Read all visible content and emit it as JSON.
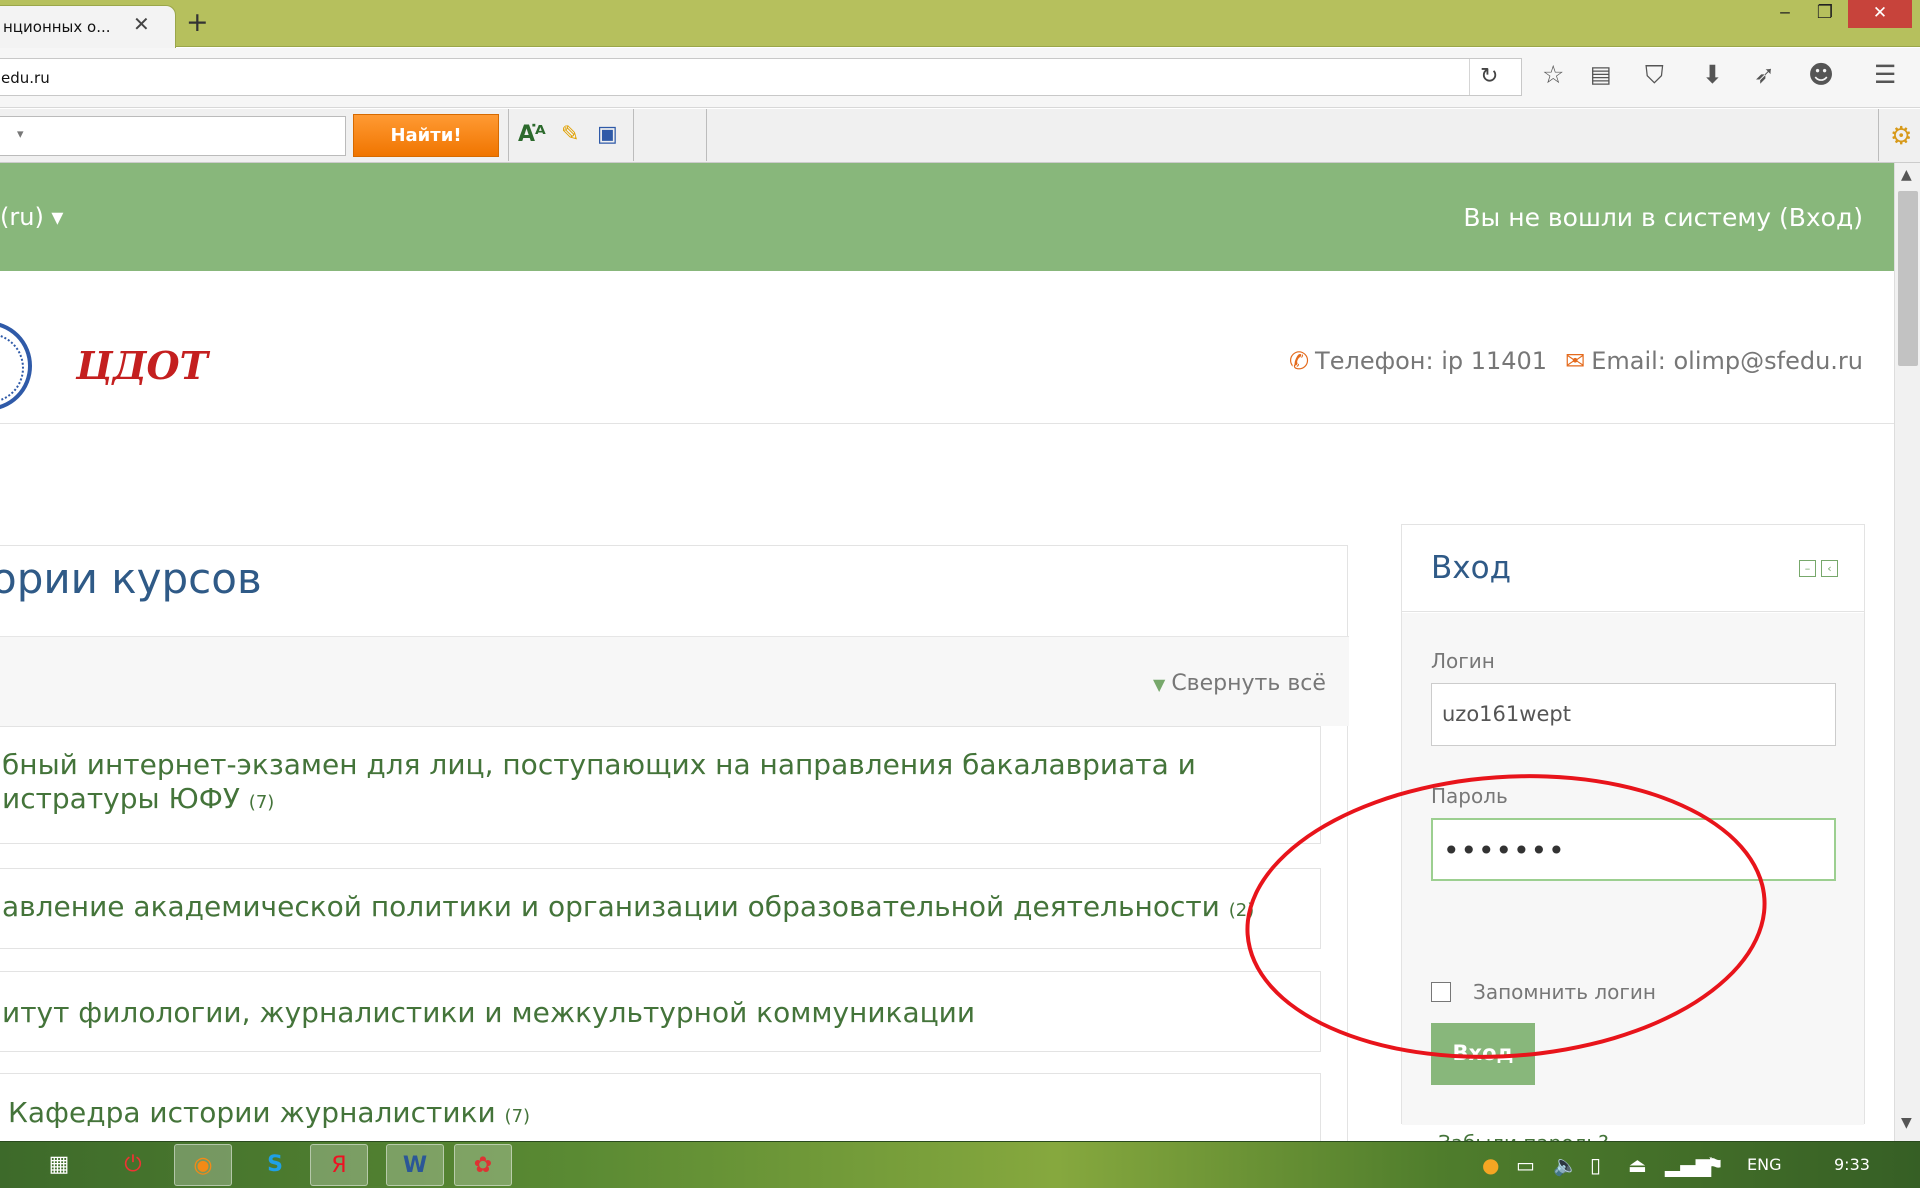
{
  "browser": {
    "tab_title": "нционных о...",
    "url": "edu.ru",
    "search_button": "Найти!",
    "controls": {
      "minimize": "‒",
      "restore": "❐",
      "close": "✕"
    }
  },
  "page": {
    "lang_menu": "(ru) ▾",
    "not_logged": "Вы не вошли в систему (Вход)",
    "logo_text": "ЦДОТ",
    "phone": "Телефон: ip 11401",
    "email": "Email: olimp@sfedu.ru",
    "categories_title": "ории курсов",
    "collapse_all": "Свернуть всё",
    "categories": [
      {
        "line1": "бный интернет-экзамен для лиц, поступающих на направления бакалавриата и",
        "line2": "истратуры ЮФУ",
        "count": "(7)"
      },
      {
        "line1": "авление академической политики и организации образовательной деятельности",
        "count": "(2)"
      },
      {
        "line1": "итут филологии, журналистики и межкультурной коммуникации",
        "count": ""
      },
      {
        "line1": "Кафедра истории журналистики",
        "count": "(7)"
      }
    ],
    "login": {
      "title": "Вход",
      "username_label": "Логин",
      "username_value": "uzo161wept",
      "password_label": "Пароль",
      "password_value": "•••••••",
      "remember_label": "Запомнить логин",
      "submit": "Вход",
      "forgot": "Забыли пароль?"
    }
  },
  "taskbar": {
    "lang": "ENG",
    "time": "9:33"
  },
  "colors": {
    "green_bar": "#88b77b",
    "link_green": "#44743a",
    "heading_blue": "#2f5a87",
    "search_orange": "#f07500",
    "annotation_red": "#e8141b"
  }
}
